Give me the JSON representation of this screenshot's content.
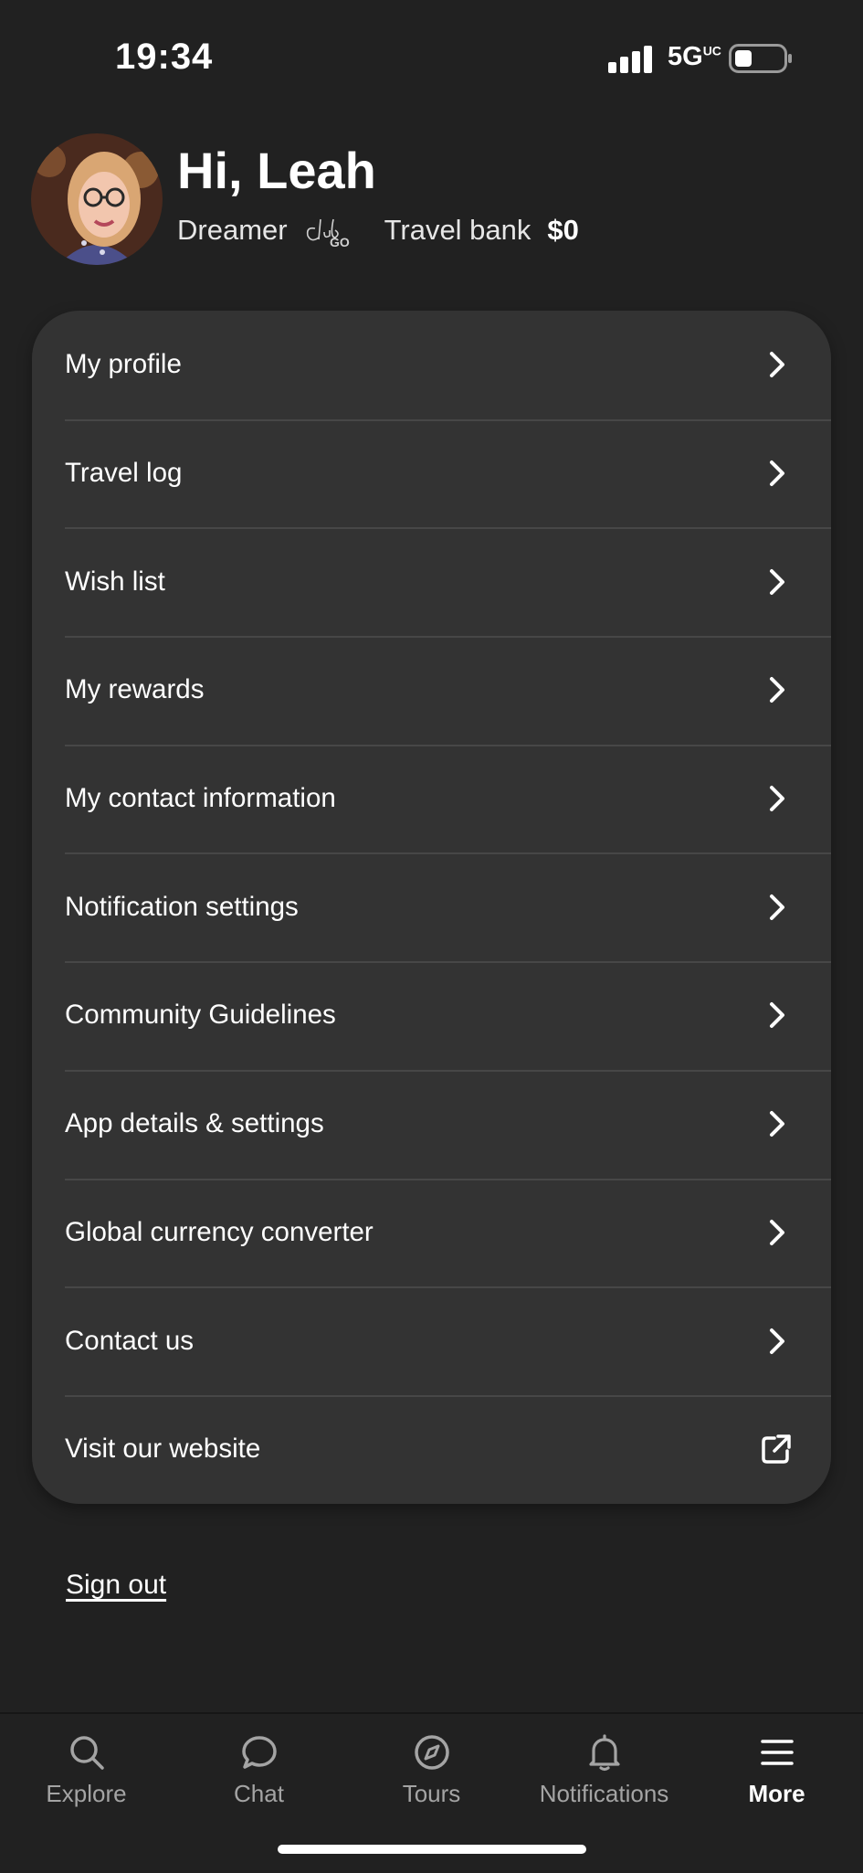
{
  "status_bar": {
    "time": "19:34",
    "network": "5G",
    "network_suffix": "UC"
  },
  "header": {
    "greeting": "Hi, Leah",
    "tier": "Dreamer",
    "club_logo": "club-go-logo",
    "bank_label": "Travel bank",
    "bank_value": "$0"
  },
  "menu": {
    "items": [
      {
        "label": "My profile",
        "icon": "chevron-right-icon"
      },
      {
        "label": "Travel log",
        "icon": "chevron-right-icon"
      },
      {
        "label": "Wish list",
        "icon": "chevron-right-icon"
      },
      {
        "label": "My rewards",
        "icon": "chevron-right-icon"
      },
      {
        "label": "My contact information",
        "icon": "chevron-right-icon"
      },
      {
        "label": "Notification settings",
        "icon": "chevron-right-icon"
      },
      {
        "label": "Community Guidelines",
        "icon": "chevron-right-icon"
      },
      {
        "label": "App details & settings",
        "icon": "chevron-right-icon"
      },
      {
        "label": "Global currency converter",
        "icon": "chevron-right-icon"
      },
      {
        "label": "Contact us",
        "icon": "chevron-right-icon"
      },
      {
        "label": "Visit our website",
        "icon": "external-link-icon"
      }
    ]
  },
  "sign_out": "Sign out",
  "tabs": [
    {
      "label": "Explore",
      "icon": "search-icon"
    },
    {
      "label": "Chat",
      "icon": "chat-bubble-icon"
    },
    {
      "label": "Tours",
      "icon": "compass-icon"
    },
    {
      "label": "Notifications",
      "icon": "bell-icon"
    },
    {
      "label": "More",
      "icon": "menu-icon",
      "active": true
    }
  ],
  "colors": {
    "background": "#212121",
    "card": "#333333",
    "divider": "#474747",
    "text": "#ffffff",
    "muted": "#a4a4a4"
  }
}
